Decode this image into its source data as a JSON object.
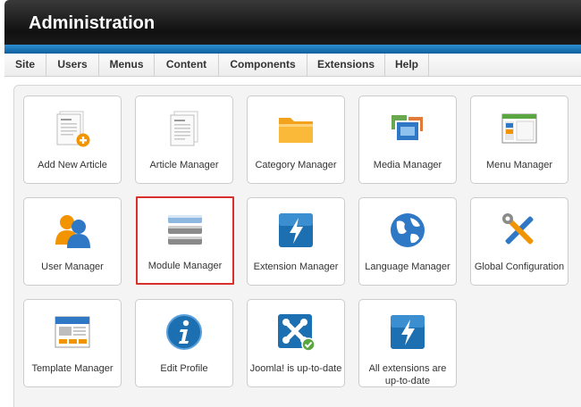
{
  "header": {
    "title": "Administration"
  },
  "menu": [
    {
      "label": "Site"
    },
    {
      "label": "Users"
    },
    {
      "label": "Menus"
    },
    {
      "label": "Content"
    },
    {
      "label": "Components"
    },
    {
      "label": "Extensions"
    },
    {
      "label": "Help"
    }
  ],
  "tiles": [
    {
      "label": "Add New Article",
      "icon": "add-article-icon"
    },
    {
      "label": "Article Manager",
      "icon": "article-icon"
    },
    {
      "label": "Category Manager",
      "icon": "folder-icon"
    },
    {
      "label": "Media Manager",
      "icon": "media-icon"
    },
    {
      "label": "Menu Manager",
      "icon": "menu-window-icon"
    },
    {
      "label": "User Manager",
      "icon": "users-icon"
    },
    {
      "label": "Module Manager",
      "icon": "module-stack-icon",
      "selected": true
    },
    {
      "label": "Extension Manager",
      "icon": "lightning-icon"
    },
    {
      "label": "Language Manager",
      "icon": "globe-icon"
    },
    {
      "label": "Global Configuration",
      "icon": "tools-icon"
    },
    {
      "label": "Template Manager",
      "icon": "template-icon"
    },
    {
      "label": "Edit Profile",
      "icon": "info-icon"
    },
    {
      "label": "Joomla! is up-to-date",
      "icon": "joomla-check-icon"
    },
    {
      "label": "All extensions are up-to-date",
      "icon": "lightning-icon"
    }
  ],
  "colors": {
    "header_bg": "#1a1a1a",
    "accent_blue": "#1a78c2",
    "selected_border": "#d9302c"
  }
}
